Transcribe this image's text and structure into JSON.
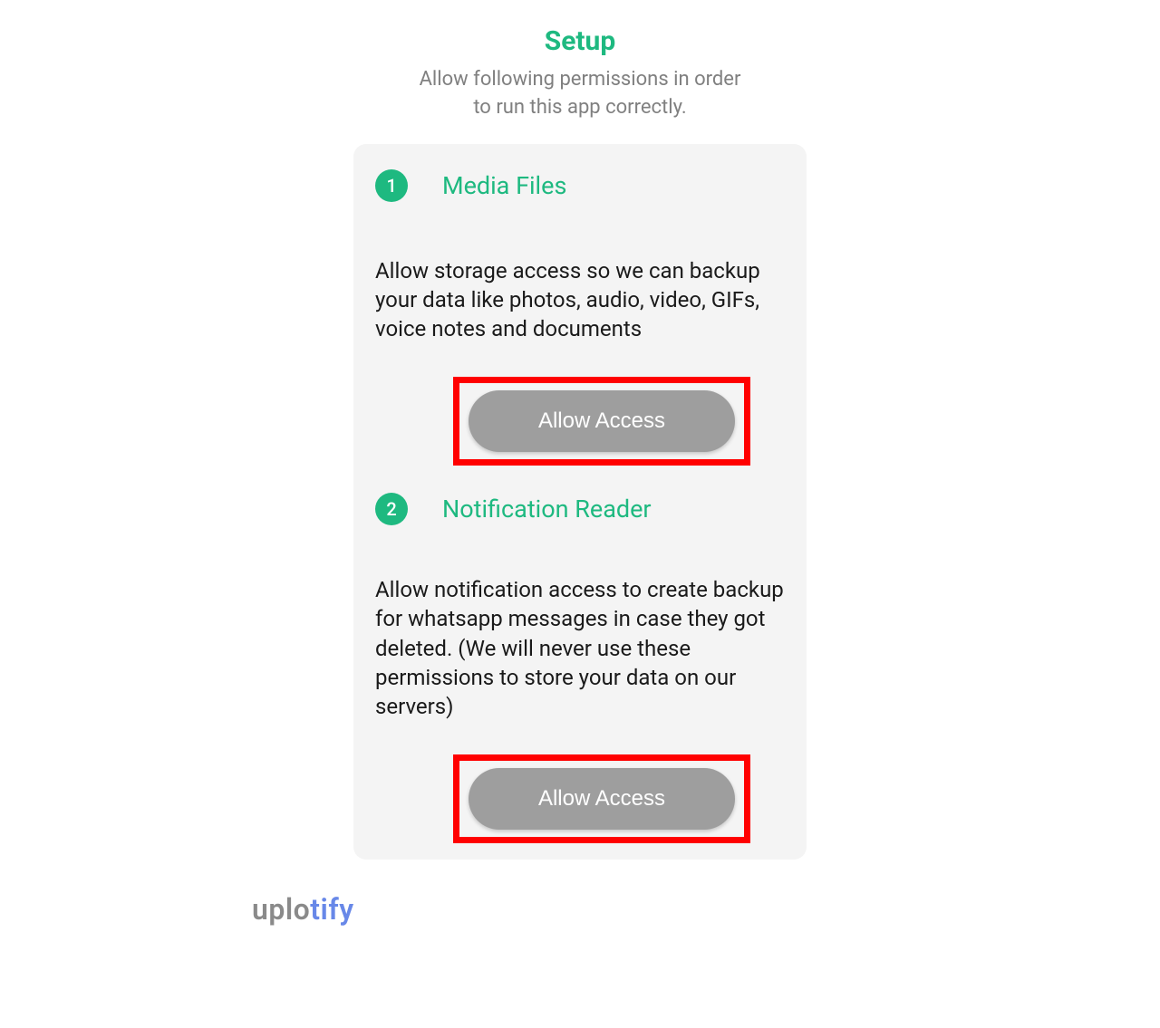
{
  "header": {
    "title": "Setup",
    "subtitle": "Allow following permissions in order to run this app correctly."
  },
  "permissions": [
    {
      "step_number": "1",
      "title": "Media Files",
      "description": "Allow storage access so we can backup your data like photos, audio, video, GIFs, voice notes and documents",
      "button_label": "Allow Access"
    },
    {
      "step_number": "2",
      "title": "Notification Reader",
      "description": "Allow notification access to create backup for whatsapp messages in case they got deleted. (We will never use these permissions to store your data on our servers)",
      "button_label": "Allow Access"
    }
  ],
  "watermark": {
    "part1": "uplo",
    "part2": "tify"
  },
  "colors": {
    "accent": "#1eb980",
    "button_bg": "#9e9e9e",
    "highlight_border": "#ff0000"
  }
}
